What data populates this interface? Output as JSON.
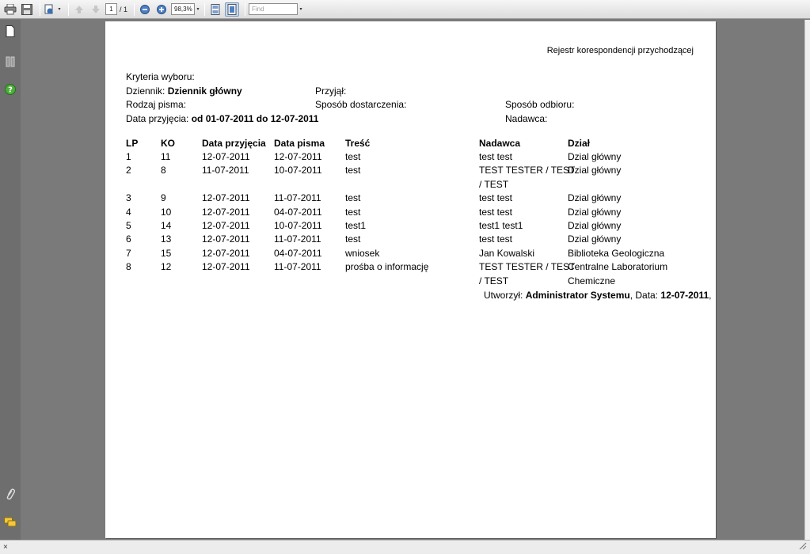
{
  "toolbar": {
    "page_current": "1",
    "page_total": "/ 1",
    "zoom": "98,3%",
    "find_placeholder": "Find"
  },
  "report": {
    "title": "Rejestr korespondencji przychodzącej",
    "criteria_heading": "Kryteria wyboru:",
    "criteria": {
      "dziennik_label": "Dziennik:",
      "dziennik_value": "Dziennik główny",
      "przyjal_label": "Przyjął:",
      "rodzaj_label": "Rodzaj pisma:",
      "sposob_dostarczenia_label": "Sposób dostarczenia:",
      "sposob_odbioru_label": "Sposób odbioru:",
      "data_przyjecia_label": "Data przyjęcia:",
      "data_przyjecia_value": "od 01-07-2011 do 12-07-2011",
      "nadawca_label": "Nadawca:"
    },
    "columns": [
      "LP",
      "KO",
      "Data przyjęcia",
      "Data pisma",
      "Treść",
      "Nadawca",
      "Dział"
    ],
    "rows": [
      {
        "lp": "1",
        "ko": "11",
        "data_przyjecia": "12-07-2011",
        "data_pisma": "12-07-2011",
        "tresc": "test",
        "nadawca": [
          "test test"
        ],
        "dzial": [
          "Dzial główny"
        ]
      },
      {
        "lp": "2",
        "ko": "8",
        "data_przyjecia": "11-07-2011",
        "data_pisma": "10-07-2011",
        "tresc": "test",
        "nadawca": [
          "TEST TESTER / TEST",
          "/ TEST"
        ],
        "dzial": [
          "Dzial główny"
        ]
      },
      {
        "lp": "3",
        "ko": "9",
        "data_przyjecia": "12-07-2011",
        "data_pisma": "11-07-2011",
        "tresc": "test",
        "nadawca": [
          "test test"
        ],
        "dzial": [
          "Dzial główny"
        ]
      },
      {
        "lp": "4",
        "ko": "10",
        "data_przyjecia": "12-07-2011",
        "data_pisma": "04-07-2011",
        "tresc": "test",
        "nadawca": [
          "test test"
        ],
        "dzial": [
          "Dzial główny"
        ]
      },
      {
        "lp": "5",
        "ko": "14",
        "data_przyjecia": "12-07-2011",
        "data_pisma": "10-07-2011",
        "tresc": "test1",
        "nadawca": [
          "test1 test1"
        ],
        "dzial": [
          "Dzial główny"
        ]
      },
      {
        "lp": "6",
        "ko": "13",
        "data_przyjecia": "12-07-2011",
        "data_pisma": "11-07-2011",
        "tresc": "test",
        "nadawca": [
          "test test"
        ],
        "dzial": [
          "Dzial główny"
        ]
      },
      {
        "lp": "7",
        "ko": "15",
        "data_przyjecia": "12-07-2011",
        "data_pisma": "04-07-2011",
        "tresc": "wniosek",
        "nadawca": [
          "Jan Kowalski"
        ],
        "dzial": [
          "Biblioteka Geologiczna"
        ]
      },
      {
        "lp": "8",
        "ko": "12",
        "data_przyjecia": "12-07-2011",
        "data_pisma": "11-07-2011",
        "tresc": "prośba o informację",
        "nadawca": [
          "TEST TESTER / TEST",
          "/ TEST"
        ],
        "dzial": [
          "Centralne Laboratorium",
          "Chemiczne"
        ]
      }
    ],
    "footer": {
      "created_label": "Utworzył:",
      "created_value": "Administrator Systemu",
      "date_label": ", Data:",
      "date_value": "12-07-2011",
      "trailing": ","
    }
  },
  "statusbar": {
    "close_glyph": "×"
  }
}
